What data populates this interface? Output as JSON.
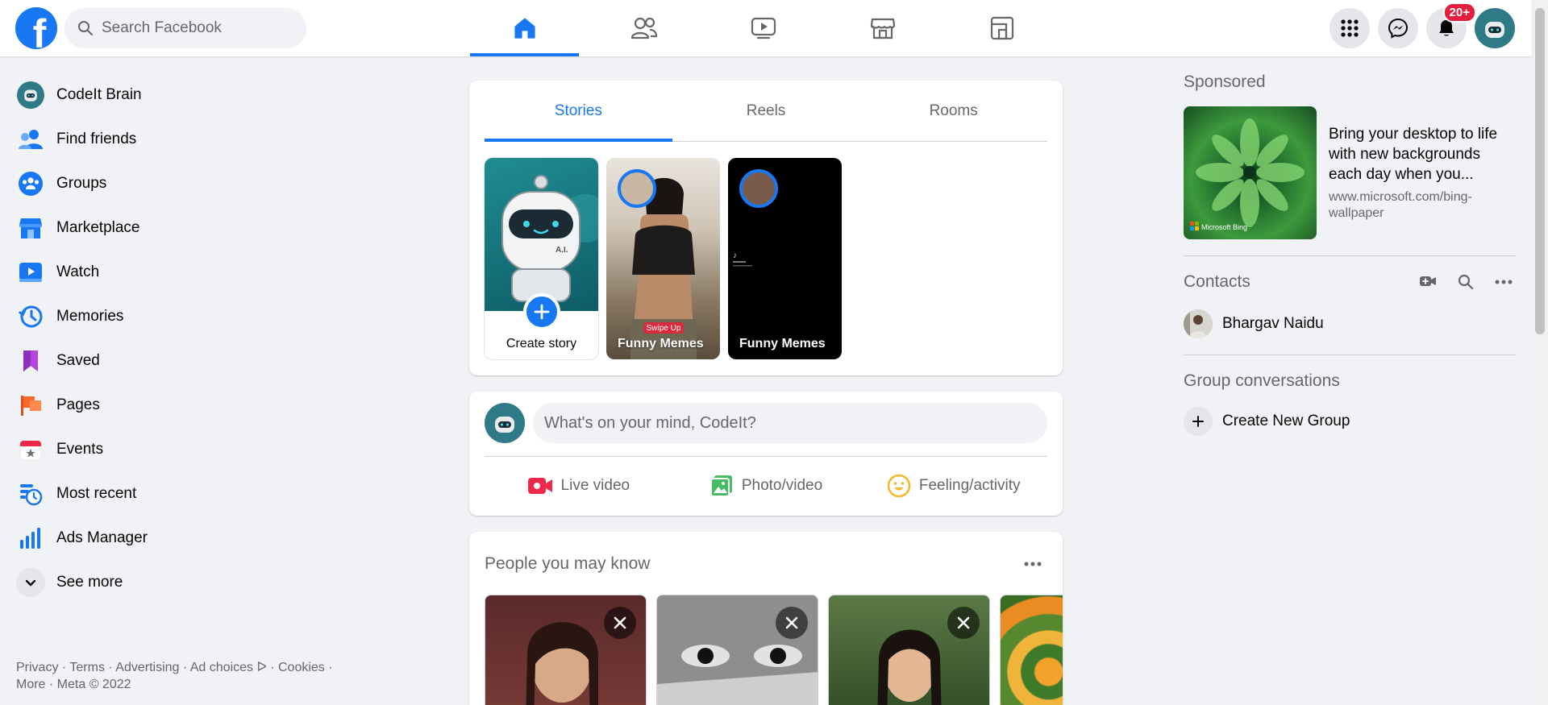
{
  "header": {
    "logo": "facebook-logo",
    "search_placeholder": "Search Facebook",
    "nav_tabs": [
      {
        "name": "home",
        "icon": "home-icon",
        "active": true
      },
      {
        "name": "friends",
        "icon": "friends-icon",
        "active": false
      },
      {
        "name": "watch",
        "icon": "watch-icon",
        "active": false
      },
      {
        "name": "marketplace",
        "icon": "marketplace-icon",
        "active": false
      },
      {
        "name": "gaming",
        "icon": "gaming-icon",
        "active": false
      }
    ],
    "notification_count": "20+",
    "accent_color": "#1877f2"
  },
  "sidebar": {
    "items": [
      {
        "label": "CodeIt Brain",
        "icon": "profile-avatar-icon"
      },
      {
        "label": "Find friends",
        "icon": "friends-icon"
      },
      {
        "label": "Groups",
        "icon": "groups-icon"
      },
      {
        "label": "Marketplace",
        "icon": "marketplace-icon"
      },
      {
        "label": "Watch",
        "icon": "watch-icon"
      },
      {
        "label": "Memories",
        "icon": "memories-clock-icon"
      },
      {
        "label": "Saved",
        "icon": "bookmark-icon"
      },
      {
        "label": "Pages",
        "icon": "flag-icon"
      },
      {
        "label": "Events",
        "icon": "calendar-icon"
      },
      {
        "label": "Most recent",
        "icon": "most-recent-icon"
      },
      {
        "label": "Ads Manager",
        "icon": "bar-chart-icon"
      },
      {
        "label": "See more",
        "icon": "chevron-down-icon"
      }
    ],
    "footer_line1": "Privacy · Terms · Advertising · Ad choices ᐅ · Cookies ·",
    "footer_line2": "More · Meta © 2022"
  },
  "stories": {
    "tabs": [
      "Stories",
      "Reels",
      "Rooms"
    ],
    "active_tab": "Stories",
    "items": [
      {
        "caption": "Create story",
        "type": "create"
      },
      {
        "caption": "Funny Memes",
        "type": "story",
        "sticker": "Swipe Up"
      },
      {
        "caption": "Funny Memes",
        "type": "story"
      }
    ]
  },
  "composer": {
    "placeholder": "What's on your mind, CodeIt?",
    "actions": [
      {
        "label": "Live video",
        "icon": "live-video-icon",
        "color": "#f02849"
      },
      {
        "label": "Photo/video",
        "icon": "photo-icon",
        "color": "#45bd62"
      },
      {
        "label": "Feeling/activity",
        "icon": "smile-icon",
        "color": "#f7b928"
      }
    ]
  },
  "people_you_may_know": {
    "title": "People you may know"
  },
  "right": {
    "sponsored_title": "Sponsored",
    "ad": {
      "title": "Bring your desktop to life with new backgrounds each day when you...",
      "url": "www.microsoft.com/bing-wallpaper",
      "brand": "Microsoft Bing"
    },
    "contacts_title": "Contacts",
    "contacts": [
      {
        "name": "Bhargav Naidu"
      }
    ],
    "group_conversations_title": "Group conversations",
    "create_group_label": "Create New Group"
  }
}
